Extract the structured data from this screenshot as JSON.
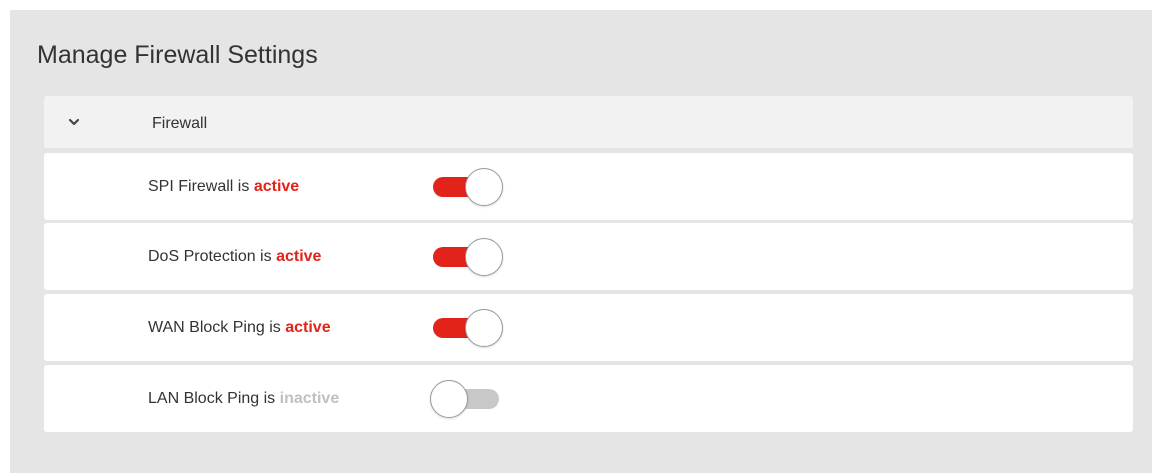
{
  "page": {
    "title": "Manage Firewall Settings"
  },
  "section": {
    "title": "Firewall",
    "expanded": true,
    "chevron_icon": "chevron-down-icon"
  },
  "colors": {
    "active": "#e2231a",
    "inactive": "#c0c0c0",
    "panel_background": "#e5e5e5"
  },
  "settings": [
    {
      "label": "SPI Firewall is",
      "status": "active",
      "enabled": true
    },
    {
      "label": "DoS Protection is",
      "status": "active",
      "enabled": true
    },
    {
      "label": "WAN Block Ping is",
      "status": "active",
      "enabled": true
    },
    {
      "label": "LAN Block Ping is",
      "status": "inactive",
      "enabled": false
    }
  ]
}
